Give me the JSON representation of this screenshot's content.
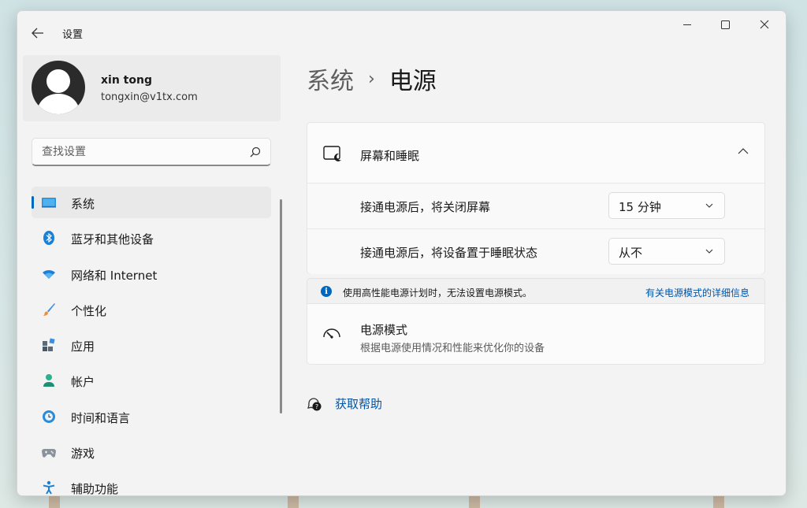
{
  "window": {
    "title": "设置",
    "controls": [
      "minimize-icon",
      "maximize-icon",
      "close-icon"
    ]
  },
  "profile": {
    "name": "xin tong",
    "email": "tongxin@v1tx.com"
  },
  "search": {
    "placeholder": "查找设置",
    "icon": "search-icon"
  },
  "sidebar": {
    "items": [
      {
        "label": "系统",
        "icon": "system-display-icon",
        "active": true
      },
      {
        "label": "蓝牙和其他设备",
        "icon": "bluetooth-icon",
        "active": false
      },
      {
        "label": "网络和 Internet",
        "icon": "wifi-icon",
        "active": false
      },
      {
        "label": "个性化",
        "icon": "paintbrush-icon",
        "active": false
      },
      {
        "label": "应用",
        "icon": "apps-icon",
        "active": false
      },
      {
        "label": "帐户",
        "icon": "account-icon",
        "active": false
      },
      {
        "label": "时间和语言",
        "icon": "globe-clock-icon",
        "active": false
      },
      {
        "label": "游戏",
        "icon": "gamepad-icon",
        "active": false
      },
      {
        "label": "辅助功能",
        "icon": "accessibility-icon",
        "active": false
      }
    ]
  },
  "breadcrumb": {
    "parent": "系统",
    "separator": "›",
    "current": "电源"
  },
  "screen_sleep": {
    "title": "屏幕和睡眠",
    "rows": [
      {
        "label": "接通电源后，将关闭屏幕",
        "value": "15 分钟"
      },
      {
        "label": "接通电源后，将设备置于睡眠状态",
        "value": "从不"
      }
    ]
  },
  "info": {
    "icon_glyph": "i",
    "text": "使用高性能电源计划时，无法设置电源模式。",
    "link": "有关电源模式的详细信息"
  },
  "power_mode": {
    "title": "电源模式",
    "subtitle": "根据电源使用情况和性能来优化你的设备"
  },
  "help": {
    "label": "获取帮助"
  },
  "colors": {
    "accent": "#0067c0",
    "link": "#0055a8",
    "window_bg": "#f3f3f3",
    "card_bg": "#fbfbfb"
  }
}
